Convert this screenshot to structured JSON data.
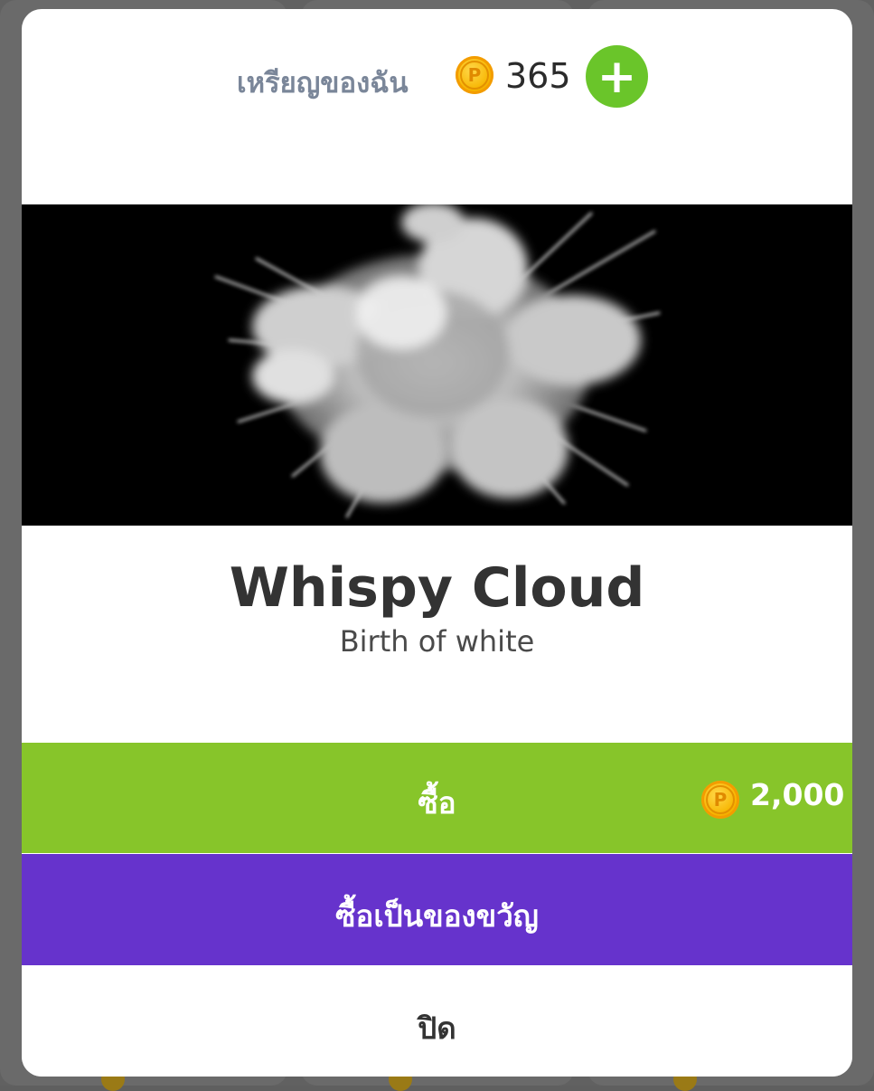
{
  "wallet": {
    "label": "เหรียญของฉัน",
    "balance": "365",
    "add_icon": "plus-icon",
    "coin_icon": "coin-icon",
    "coin_symbol": "P"
  },
  "item": {
    "title": "Whispy Cloud",
    "subtitle": "Birth of white",
    "preview_name": "white-powder-explosion"
  },
  "actions": {
    "buy_label": "ซื้อ",
    "price": "2,000",
    "gift_label": "ซื้อเป็นของขวัญ",
    "close_label": "ปิด"
  },
  "colors": {
    "accent_green": "#87c52a",
    "add_green": "#6ac52a",
    "gift_purple": "#6633cc",
    "coin_gold": "#f7b500"
  }
}
